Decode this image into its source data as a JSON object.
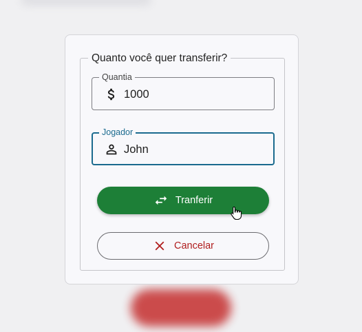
{
  "dialog": {
    "legend": "Quanto você quer transferir?",
    "amount_field": {
      "label": "Quantia",
      "value": "1000",
      "icon": "dollar-icon"
    },
    "player_field": {
      "label": "Jogador",
      "value": "John",
      "icon": "person-icon"
    },
    "transfer_button": {
      "label": "Tranferir",
      "icon": "swap-arrows-icon"
    },
    "cancel_button": {
      "label": "Cancelar",
      "icon": "close-icon"
    }
  },
  "colors": {
    "primary": "#1d7f37",
    "focus": "#1a6a8e",
    "danger": "#b01d1d"
  }
}
